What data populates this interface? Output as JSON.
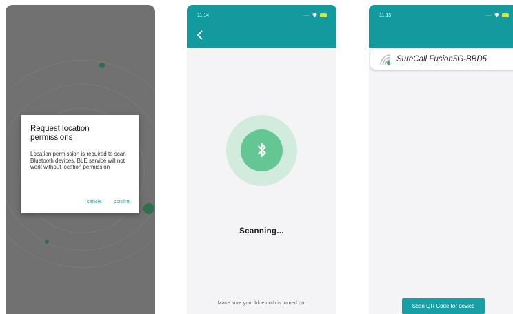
{
  "screen1": {
    "dialog": {
      "title": "Request location permissions",
      "body": "Location permission is required to scan Bluetooth devices. BLE service will not work without location permission",
      "cancel_label": "cancel",
      "confirm_label": "confirm"
    }
  },
  "screen2": {
    "status": {
      "time": "11:14",
      "signal": "...."
    },
    "scanning_text": "Scanning...",
    "hint": "Make sure your bluetooth is turned on.",
    "icons": [
      "back-arrow-icon",
      "wifi-icon",
      "battery-icon",
      "bluetooth-icon"
    ]
  },
  "screen3": {
    "status": {
      "time": "11:13",
      "signal": "...."
    },
    "device_name": "SureCall Fusion5G-BBD5",
    "qr_button_label": "Scan QR Code for device",
    "icons": [
      "signal-strength-icon",
      "wifi-icon",
      "battery-icon"
    ]
  },
  "colors": {
    "teal_appbar": "#139a9e",
    "teal_button": "#169fa4",
    "bluetooth_green": "#64c692",
    "bluetooth_halo": "#d1ebdc",
    "dialog_accent": "#1aa1a8",
    "overlay_gray": "#717171",
    "battery_yellow": "#cfe84a"
  }
}
